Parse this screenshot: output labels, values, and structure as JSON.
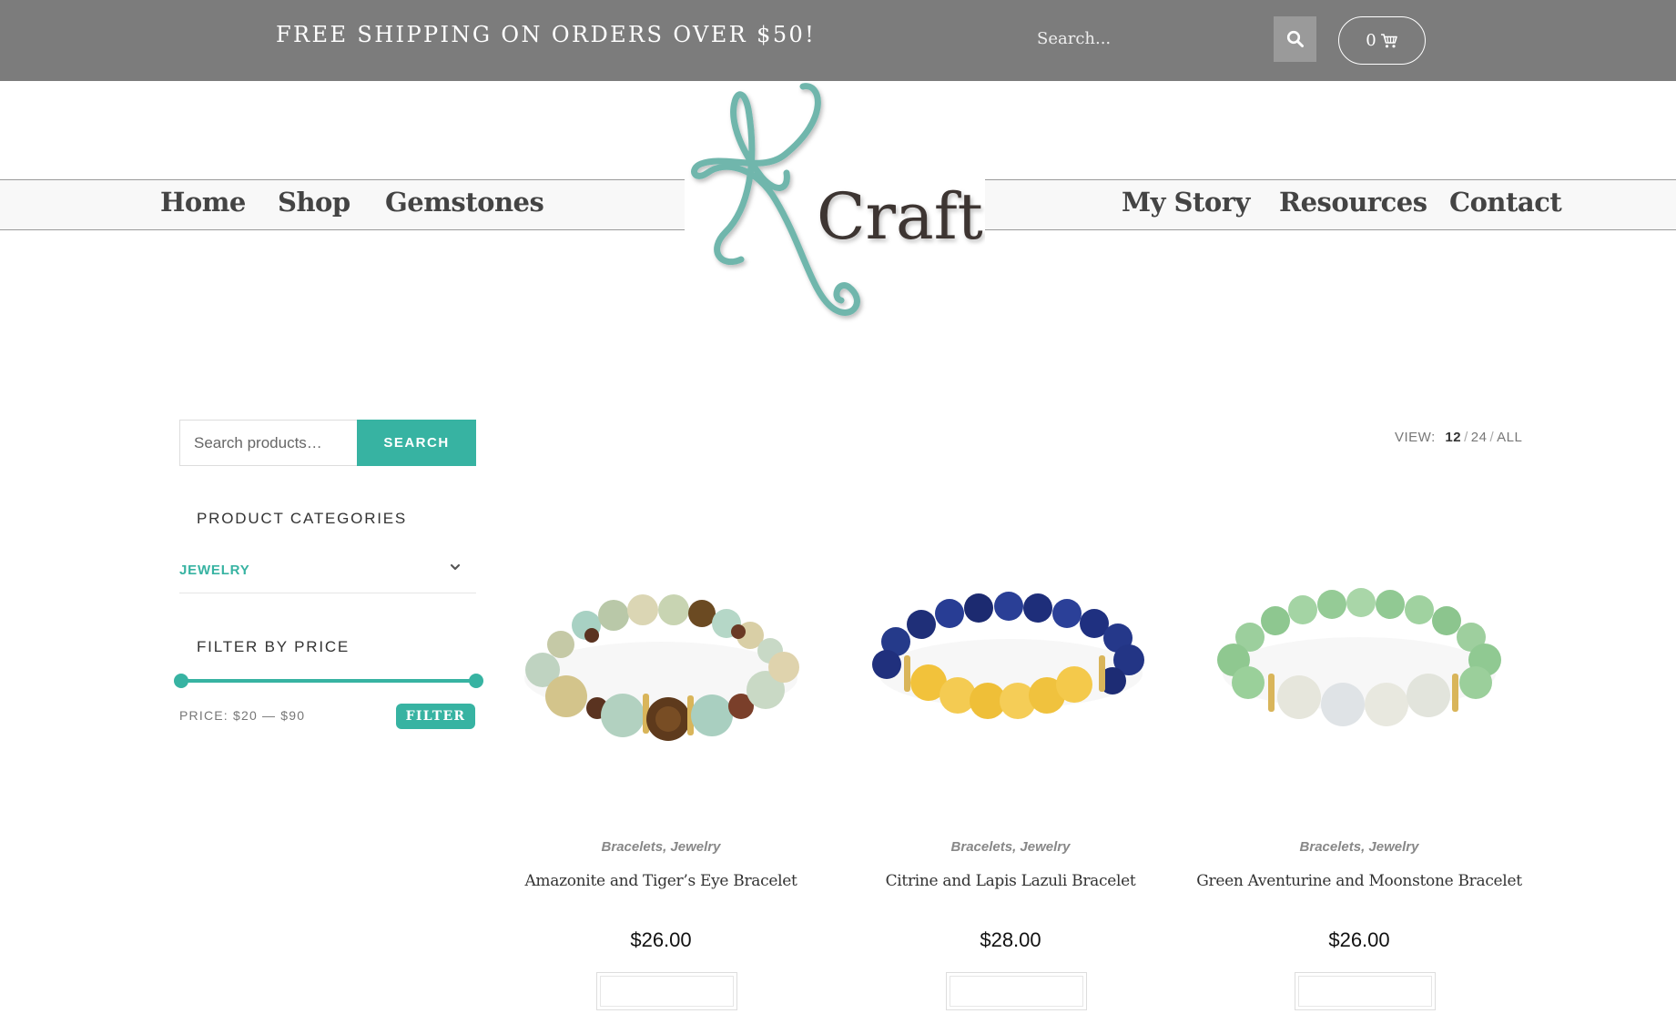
{
  "topbar": {
    "promo": "FREE SHIPPING ON ORDERS OVER $50!",
    "search_placeholder": "Search...",
    "search_icon": "search-icon",
    "cart_count": "0",
    "cart_icon": "cart-icon"
  },
  "nav": {
    "left": [
      {
        "label": "Home"
      },
      {
        "label": "Shop"
      },
      {
        "label": "Gemstones"
      }
    ],
    "right": [
      {
        "label": "My Story"
      },
      {
        "label": "Resources"
      },
      {
        "label": "Contact"
      }
    ]
  },
  "logo": {
    "initial": "K",
    "text": "Crafts",
    "colors": {
      "k": "#6fb6ac",
      "text": "#3d3431"
    }
  },
  "sidebar": {
    "search_placeholder": "Search products…",
    "search_button": "SEARCH",
    "categories_title": "PRODUCT CATEGORIES",
    "category": "JEWELRY",
    "filter_title": "FILTER BY PRICE",
    "price_label": "PRICE: $20 — $90",
    "filter_button": "FILTER"
  },
  "view": {
    "label": "VIEW:",
    "options": [
      "12",
      "24",
      "ALL"
    ],
    "active": "12"
  },
  "products": [
    {
      "cats": "Bracelets, Jewelry",
      "name": "Amazonite and Tiger’s Eye Bracelet",
      "price": "$26.00"
    },
    {
      "cats": "Bracelets, Jewelry",
      "name": "Citrine and Lapis Lazuli Bracelet",
      "price": "$28.00"
    },
    {
      "cats": "Bracelets, Jewelry",
      "name": "Green Aventurine and Moonstone Bracelet",
      "price": "$26.00"
    }
  ],
  "colors": {
    "accent": "#37b3a2",
    "topbar": "#7c7c7c"
  }
}
